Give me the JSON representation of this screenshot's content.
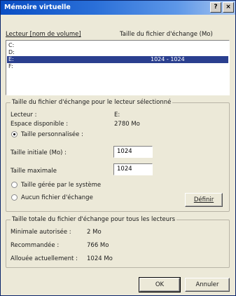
{
  "window": {
    "title": "Mémoire virtuelle",
    "help_label": "?",
    "close_label": "×"
  },
  "list": {
    "header_drive": "Lecteur [nom de volume]",
    "header_size": "Taille du fichier d'échange (Mo)",
    "items": [
      {
        "drive": "C:",
        "size": ""
      },
      {
        "drive": "D:",
        "size": ""
      },
      {
        "drive": "E:",
        "size": "1024 - 1024",
        "selected": true
      },
      {
        "drive": "F:",
        "size": ""
      }
    ]
  },
  "selected_group": {
    "title": "Taille du fichier d'échange pour le lecteur sélectionné",
    "drive_label": "Lecteur :",
    "drive_value": "E:",
    "free_label": "Espace disponible :",
    "free_value": "2780 Mo",
    "custom_label": "Taille personnalisée :",
    "initial_label": "Taille initiale (Mo) :",
    "initial_value": "1024",
    "max_label": "Taille maximale",
    "max_value": "1024",
    "system_label": "Taille gérée par le système",
    "none_label": "Aucun fichier d'échange",
    "define_label": "Définir",
    "selected_option": "custom"
  },
  "total_group": {
    "title": "Taille totale du fichier d'échange pour tous les lecteurs",
    "min_label": "Minimale autorisée :",
    "min_value": "2 Mo",
    "rec_label": "Recommandée :",
    "rec_value": "766 Mo",
    "alloc_label": "Allouée actuellement :",
    "alloc_value": "1024 Mo"
  },
  "footer": {
    "ok_label": "OK",
    "cancel_label": "Annuler"
  }
}
